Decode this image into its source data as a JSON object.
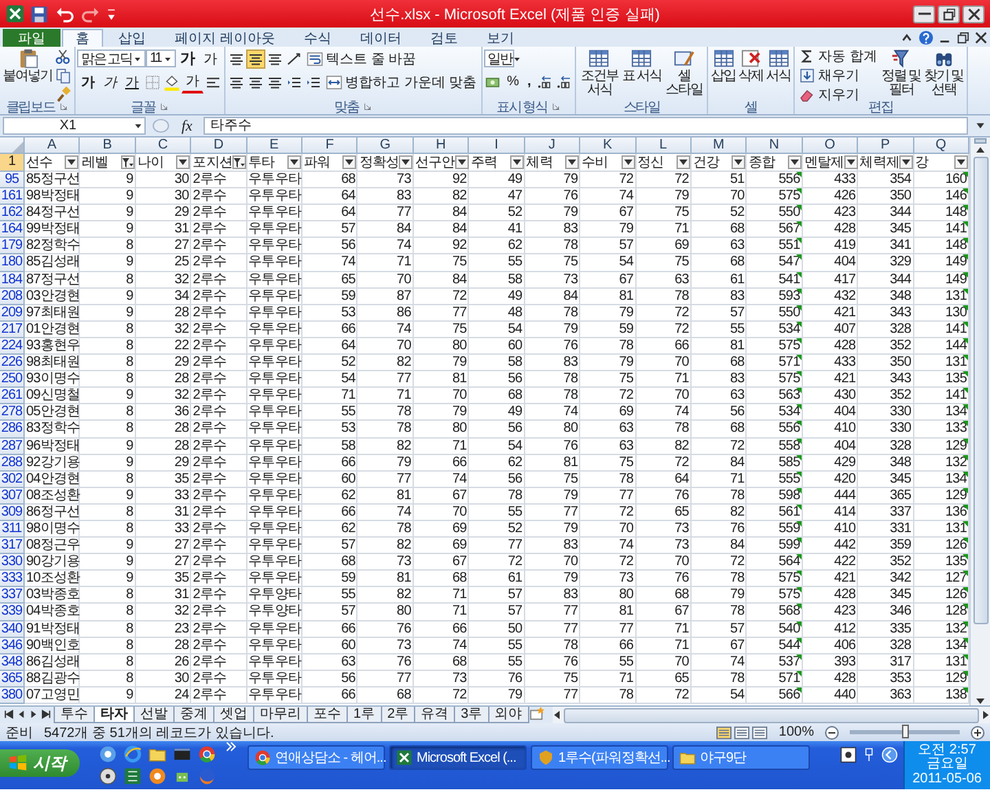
{
  "window": {
    "title": "선수.xlsx  -  Microsoft Excel (제품 인증 실패)"
  },
  "ribbon_tabs": [
    {
      "label": "파일",
      "kind": "file",
      "selected": false
    },
    {
      "label": "홈",
      "kind": "tab",
      "selected": true
    },
    {
      "label": "삽입",
      "kind": "tab",
      "selected": false
    },
    {
      "label": "페이지 레이아웃",
      "kind": "tab",
      "selected": false
    },
    {
      "label": "수식",
      "kind": "tab",
      "selected": false
    },
    {
      "label": "데이터",
      "kind": "tab",
      "selected": false
    },
    {
      "label": "검토",
      "kind": "tab",
      "selected": false
    },
    {
      "label": "보기",
      "kind": "tab",
      "selected": false
    }
  ],
  "ribbon_groups": [
    {
      "label": "클립보드",
      "launcher": true,
      "items": [
        {
          "kind": "large",
          "label": "붙여넣기"
        },
        {
          "kind": "stack",
          "lines": [
            {
              "controls": [
                {
                  "kind": "tool"
                }
              ]
            },
            {
              "controls": [
                {
                  "kind": "tool"
                }
              ]
            },
            {
              "controls": [
                {
                  "kind": "tool"
                }
              ]
            }
          ]
        }
      ]
    },
    {
      "label": "글꼴",
      "launcher": true,
      "items": [
        {
          "kind": "stack",
          "lines": [
            {
              "controls": [
                {
                  "kind": "field",
                  "value": "맑은 고딕"
                },
                {
                  "kind": "field",
                  "value": "11"
                },
                {
                  "kind": "glyph",
                  "label": "가"
                },
                {
                  "kind": "glyph",
                  "label": "가"
                }
              ]
            },
            {
              "controls": [
                {
                  "kind": "glyph",
                  "label": "가"
                },
                {
                  "kind": "glyph",
                  "label": "가"
                },
                {
                  "kind": "glyph",
                  "label": "가"
                },
                {
                  "kind": "tool"
                },
                {
                  "kind": "tool"
                },
                {
                  "kind": "glyph",
                  "label": "가"
                },
                {
                  "kind": "tool"
                }
              ]
            }
          ]
        }
      ]
    },
    {
      "label": "맞춤",
      "launcher": true,
      "items": [
        {
          "kind": "stack",
          "lines": [
            {
              "controls": [
                {
                  "kind": "toggle",
                  "selected": false
                },
                {
                  "kind": "toggle",
                  "selected": true
                },
                {
                  "kind": "toggle",
                  "selected": false
                },
                {
                  "kind": "tool"
                },
                {
                  "kind": "small",
                  "label": "텍스트 줄 바꿈"
                }
              ]
            },
            {
              "controls": [
                {
                  "kind": "toggle",
                  "selected": false
                },
                {
                  "kind": "toggle",
                  "selected": false
                },
                {
                  "kind": "toggle",
                  "selected": false
                },
                {
                  "kind": "tool"
                },
                {
                  "kind": "tool"
                },
                {
                  "kind": "small",
                  "label": "병합하고 가운데 맞춤"
                }
              ]
            }
          ]
        }
      ]
    },
    {
      "label": "표시 형식",
      "launcher": true,
      "items": [
        {
          "kind": "stack",
          "lines": [
            {
              "controls": [
                {
                  "kind": "field",
                  "value": "일반"
                }
              ]
            },
            {
              "controls": [
                {
                  "kind": "tool"
                },
                {
                  "kind": "glyph",
                  "label": "%"
                },
                {
                  "kind": "glyph",
                  "label": ","
                },
                {
                  "kind": "tool"
                },
                {
                  "kind": "tool"
                }
              ]
            }
          ]
        }
      ]
    },
    {
      "label": "스타일",
      "launcher": false,
      "items": [
        {
          "kind": "large",
          "label": "조건부 서식"
        },
        {
          "kind": "large",
          "label": "표 서식"
        },
        {
          "kind": "large",
          "label": "셀 스타일"
        }
      ]
    },
    {
      "label": "셀",
      "launcher": false,
      "items": [
        {
          "kind": "large",
          "label": "삽입"
        },
        {
          "kind": "large",
          "label": "삭제"
        },
        {
          "kind": "large",
          "label": "서식"
        }
      ]
    },
    {
      "label": "편집",
      "launcher": false,
      "items": [
        {
          "kind": "stack",
          "lines": [
            {
              "controls": [
                {
                  "kind": "small",
                  "label": "자동 합계"
                }
              ]
            },
            {
              "controls": [
                {
                  "kind": "small",
                  "label": "채우기"
                }
              ]
            },
            {
              "controls": [
                {
                  "kind": "small",
                  "label": "지우기"
                }
              ]
            }
          ]
        },
        {
          "kind": "large",
          "label": "정렬 및 필터"
        },
        {
          "kind": "large",
          "label": "찾기 및 선택"
        }
      ]
    }
  ],
  "formula_bar": {
    "name_box": "X1",
    "function_label": "fx",
    "value": "타주수"
  },
  "sheet": {
    "filter_active": true,
    "columns": [
      {
        "letter": "A",
        "kind": "text",
        "warning_mark": false
      },
      {
        "letter": "B",
        "kind": "number",
        "warning_mark": false
      },
      {
        "letter": "C",
        "kind": "number",
        "warning_mark": false
      },
      {
        "letter": "D",
        "kind": "text",
        "warning_mark": false
      },
      {
        "letter": "E",
        "kind": "text",
        "warning_mark": false
      },
      {
        "letter": "F",
        "kind": "number",
        "warning_mark": false
      },
      {
        "letter": "G",
        "kind": "number",
        "warning_mark": false
      },
      {
        "letter": "H",
        "kind": "number",
        "warning_mark": false
      },
      {
        "letter": "I",
        "kind": "number",
        "warning_mark": false
      },
      {
        "letter": "J",
        "kind": "number",
        "warning_mark": false
      },
      {
        "letter": "K",
        "kind": "number",
        "warning_mark": false
      },
      {
        "letter": "L",
        "kind": "number",
        "warning_mark": false
      },
      {
        "letter": "M",
        "kind": "number",
        "warning_mark": false
      },
      {
        "letter": "N",
        "kind": "number",
        "warning_mark": true
      },
      {
        "letter": "O",
        "kind": "number",
        "warning_mark": false
      },
      {
        "letter": "P",
        "kind": "number",
        "warning_mark": false
      },
      {
        "letter": "Q",
        "kind": "number",
        "warning_mark": true
      }
    ],
    "header_row": {
      "row": "1",
      "highlighted": true,
      "cells": [
        {
          "label": "선수",
          "filter_on": false
        },
        {
          "label": "레벨",
          "filter_on": true
        },
        {
          "label": "나이",
          "filter_on": false
        },
        {
          "label": "포지션",
          "filter_on": true
        },
        {
          "label": "투타",
          "filter_on": false
        },
        {
          "label": "파워",
          "filter_on": false
        },
        {
          "label": "정확성",
          "filter_on": false
        },
        {
          "label": "선구안",
          "filter_on": false
        },
        {
          "label": "주력",
          "filter_on": false
        },
        {
          "label": "체력",
          "filter_on": false
        },
        {
          "label": "수비",
          "filter_on": false
        },
        {
          "label": "정신",
          "filter_on": false
        },
        {
          "label": "건강",
          "filter_on": false
        },
        {
          "label": "종합",
          "filter_on": false
        },
        {
          "label": "멘탈제",
          "filter_on": false
        },
        {
          "label": "체력제",
          "filter_on": false
        },
        {
          "label": "강",
          "filter_on": false
        }
      ]
    },
    "rows": [
      {
        "row": "95",
        "cells": [
          "85정구선",
          "9",
          "30",
          "2루수",
          "우투우타",
          "68",
          "73",
          "92",
          "49",
          "79",
          "72",
          "72",
          "51",
          "556",
          "433",
          "354",
          "160"
        ]
      },
      {
        "row": "161",
        "cells": [
          "98박정태",
          "9",
          "30",
          "2루수",
          "우투우타",
          "64",
          "83",
          "82",
          "47",
          "76",
          "74",
          "79",
          "70",
          "575",
          "426",
          "350",
          "146"
        ]
      },
      {
        "row": "162",
        "cells": [
          "84정구선",
          "9",
          "29",
          "2루수",
          "우투우타",
          "64",
          "77",
          "84",
          "52",
          "79",
          "67",
          "75",
          "52",
          "550",
          "423",
          "344",
          "148"
        ]
      },
      {
        "row": "164",
        "cells": [
          "99박정태",
          "9",
          "31",
          "2루수",
          "우투우타",
          "57",
          "84",
          "84",
          "41",
          "83",
          "79",
          "71",
          "68",
          "567",
          "428",
          "345",
          "141"
        ]
      },
      {
        "row": "179",
        "cells": [
          "82정학수",
          "8",
          "27",
          "2루수",
          "우투우타",
          "56",
          "74",
          "92",
          "62",
          "78",
          "57",
          "69",
          "63",
          "551",
          "419",
          "341",
          "148"
        ]
      },
      {
        "row": "180",
        "cells": [
          "85김성래",
          "9",
          "25",
          "2루수",
          "우투우타",
          "74",
          "71",
          "75",
          "55",
          "75",
          "54",
          "75",
          "68",
          "547",
          "404",
          "329",
          "149"
        ]
      },
      {
        "row": "184",
        "cells": [
          "87정구선",
          "8",
          "32",
          "2루수",
          "우투우타",
          "65",
          "70",
          "84",
          "58",
          "73",
          "67",
          "63",
          "61",
          "541",
          "417",
          "344",
          "149"
        ]
      },
      {
        "row": "208",
        "cells": [
          "03안경현",
          "9",
          "34",
          "2루수",
          "우투우타",
          "59",
          "87",
          "72",
          "49",
          "84",
          "81",
          "78",
          "83",
          "593",
          "432",
          "348",
          "131"
        ]
      },
      {
        "row": "209",
        "cells": [
          "97최태원",
          "9",
          "28",
          "2루수",
          "우투우타",
          "53",
          "86",
          "77",
          "48",
          "78",
          "79",
          "72",
          "57",
          "550",
          "421",
          "343",
          "130"
        ]
      },
      {
        "row": "217",
        "cells": [
          "01안경현",
          "8",
          "32",
          "2루수",
          "우투우타",
          "66",
          "74",
          "75",
          "54",
          "79",
          "59",
          "72",
          "55",
          "534",
          "407",
          "328",
          "141"
        ]
      },
      {
        "row": "224",
        "cells": [
          "93홍현우",
          "8",
          "22",
          "2루수",
          "우투우타",
          "64",
          "70",
          "80",
          "60",
          "76",
          "78",
          "66",
          "81",
          "575",
          "428",
          "352",
          "144"
        ]
      },
      {
        "row": "226",
        "cells": [
          "98최태원",
          "8",
          "29",
          "2루수",
          "우투우타",
          "52",
          "82",
          "79",
          "58",
          "83",
          "79",
          "70",
          "68",
          "571",
          "433",
          "350",
          "131"
        ]
      },
      {
        "row": "250",
        "cells": [
          "93이명수",
          "8",
          "28",
          "2루수",
          "우투우타",
          "54",
          "77",
          "81",
          "56",
          "78",
          "75",
          "71",
          "83",
          "575",
          "421",
          "343",
          "135"
        ]
      },
      {
        "row": "261",
        "cells": [
          "09신명철",
          "9",
          "32",
          "2루수",
          "우투우타",
          "71",
          "71",
          "70",
          "68",
          "78",
          "72",
          "70",
          "63",
          "563",
          "430",
          "352",
          "141"
        ]
      },
      {
        "row": "278",
        "cells": [
          "05안경현",
          "8",
          "36",
          "2루수",
          "우투우타",
          "55",
          "78",
          "79",
          "49",
          "74",
          "69",
          "74",
          "56",
          "534",
          "404",
          "330",
          "134"
        ]
      },
      {
        "row": "286",
        "cells": [
          "83정학수",
          "8",
          "28",
          "2루수",
          "우투우타",
          "53",
          "78",
          "80",
          "56",
          "80",
          "63",
          "78",
          "68",
          "556",
          "410",
          "330",
          "133"
        ]
      },
      {
        "row": "287",
        "cells": [
          "96박정태",
          "9",
          "28",
          "2루수",
          "우투우타",
          "58",
          "82",
          "71",
          "54",
          "76",
          "63",
          "82",
          "72",
          "558",
          "404",
          "328",
          "129"
        ]
      },
      {
        "row": "288",
        "cells": [
          "92강기용",
          "9",
          "29",
          "2루수",
          "우투우타",
          "66",
          "79",
          "66",
          "62",
          "81",
          "75",
          "72",
          "84",
          "585",
          "429",
          "348",
          "132"
        ]
      },
      {
        "row": "302",
        "cells": [
          "04안경현",
          "8",
          "35",
          "2루수",
          "우투우타",
          "60",
          "77",
          "74",
          "56",
          "75",
          "78",
          "64",
          "71",
          "555",
          "420",
          "345",
          "134"
        ]
      },
      {
        "row": "307",
        "cells": [
          "08조성환",
          "9",
          "33",
          "2루수",
          "우투우타",
          "62",
          "81",
          "67",
          "78",
          "79",
          "77",
          "76",
          "78",
          "598",
          "444",
          "365",
          "129"
        ]
      },
      {
        "row": "309",
        "cells": [
          "86정구선",
          "8",
          "31",
          "2루수",
          "우투우타",
          "66",
          "74",
          "70",
          "55",
          "77",
          "72",
          "65",
          "82",
          "561",
          "414",
          "337",
          "136"
        ]
      },
      {
        "row": "311",
        "cells": [
          "98이명수",
          "8",
          "33",
          "2루수",
          "우투우타",
          "62",
          "78",
          "69",
          "52",
          "79",
          "70",
          "73",
          "76",
          "559",
          "410",
          "331",
          "131"
        ]
      },
      {
        "row": "317",
        "cells": [
          "08정근우",
          "9",
          "27",
          "2루수",
          "우투우타",
          "57",
          "82",
          "69",
          "77",
          "83",
          "74",
          "73",
          "84",
          "599",
          "442",
          "359",
          "126"
        ]
      },
      {
        "row": "330",
        "cells": [
          "90강기용",
          "9",
          "27",
          "2루수",
          "우투우타",
          "68",
          "73",
          "67",
          "72",
          "70",
          "72",
          "70",
          "72",
          "564",
          "422",
          "352",
          "135"
        ]
      },
      {
        "row": "333",
        "cells": [
          "10조성환",
          "9",
          "35",
          "2루수",
          "우투우타",
          "59",
          "81",
          "68",
          "61",
          "79",
          "73",
          "76",
          "78",
          "575",
          "421",
          "342",
          "127"
        ]
      },
      {
        "row": "337",
        "cells": [
          "03박종호",
          "8",
          "31",
          "2루수",
          "우투양타",
          "55",
          "82",
          "71",
          "57",
          "83",
          "80",
          "68",
          "79",
          "575",
          "428",
          "345",
          "126"
        ]
      },
      {
        "row": "339",
        "cells": [
          "04박종호",
          "8",
          "32",
          "2루수",
          "우투양타",
          "57",
          "80",
          "71",
          "57",
          "77",
          "81",
          "67",
          "78",
          "568",
          "423",
          "346",
          "128"
        ]
      },
      {
        "row": "340",
        "cells": [
          "91박정태",
          "8",
          "23",
          "2루수",
          "우투우타",
          "66",
          "76",
          "66",
          "50",
          "77",
          "77",
          "71",
          "57",
          "540",
          "412",
          "335",
          "132"
        ]
      },
      {
        "row": "346",
        "cells": [
          "90백인호",
          "8",
          "28",
          "2루수",
          "우투우타",
          "60",
          "73",
          "74",
          "55",
          "78",
          "66",
          "71",
          "67",
          "544",
          "406",
          "328",
          "134"
        ]
      },
      {
        "row": "348",
        "cells": [
          "86김성래",
          "8",
          "26",
          "2루수",
          "우투우타",
          "63",
          "76",
          "68",
          "55",
          "76",
          "55",
          "70",
          "74",
          "537",
          "393",
          "317",
          "131"
        ]
      },
      {
        "row": "365",
        "cells": [
          "88김광수",
          "8",
          "30",
          "2루수",
          "우투우타",
          "56",
          "77",
          "73",
          "76",
          "75",
          "71",
          "65",
          "78",
          "571",
          "428",
          "353",
          "129"
        ]
      },
      {
        "row": "380",
        "cells": [
          "07고영민",
          "9",
          "24",
          "2루수",
          "우투우타",
          "66",
          "68",
          "72",
          "79",
          "77",
          "78",
          "72",
          "54",
          "566",
          "440",
          "363",
          "138"
        ]
      }
    ]
  },
  "sheet_tabs": [
    {
      "label": "투수",
      "selected": false
    },
    {
      "label": "타자",
      "selected": true
    },
    {
      "label": "선발",
      "selected": false
    },
    {
      "label": "중계",
      "selected": false
    },
    {
      "label": "셋업",
      "selected": false
    },
    {
      "label": "마무리",
      "selected": false
    },
    {
      "label": "포수",
      "selected": false
    },
    {
      "label": "1루",
      "selected": false
    },
    {
      "label": "2루",
      "selected": false
    },
    {
      "label": "유격",
      "selected": false
    },
    {
      "label": "3루",
      "selected": false
    },
    {
      "label": "외야",
      "selected": false
    }
  ],
  "status_bar": {
    "mode": "준비",
    "message": "5472개 중 51개의 레코드가 있습니다.",
    "zoom_label": "100%",
    "zoom": {
      "level": 0.5
    }
  },
  "taskbar": {
    "start_label": "시작",
    "tasks": [
      {
        "label": "연애상담소 - 헤어...",
        "selected": false
      },
      {
        "label": "Microsoft Excel (...",
        "selected": true
      },
      {
        "label": "1루수(파워정확선...",
        "selected": false
      },
      {
        "label": "야구9단",
        "selected": false
      }
    ],
    "clock": {
      "time": "오전 2:57",
      "day": "금요일",
      "date": "2011-05-06"
    }
  }
}
